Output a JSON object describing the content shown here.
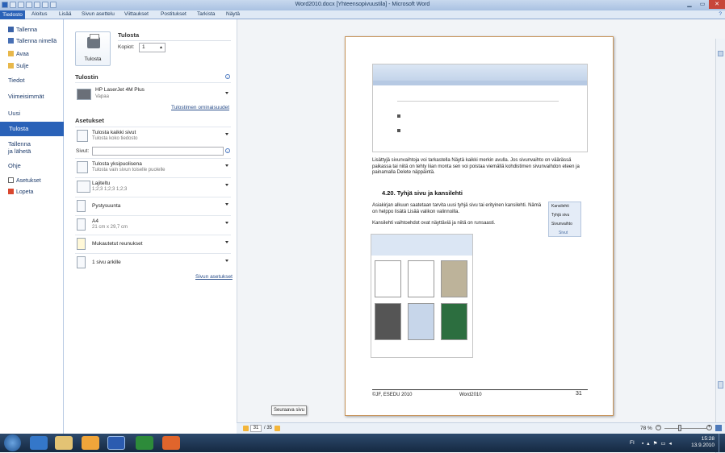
{
  "window": {
    "title": "Word2010.docx [Yhteensopivuustila] - Microsoft Word"
  },
  "ribbon": {
    "file": "Tiedosto",
    "tabs": [
      "Aloitus",
      "Lisää",
      "Sivun asettelu",
      "Viittaukset",
      "Postitukset",
      "Tarkista",
      "Näytä"
    ]
  },
  "nav": {
    "save": "Tallenna",
    "save_as": "Tallenna nimellä",
    "open": "Avaa",
    "close": "Sulje",
    "info": "Tiedot",
    "recent": "Viimeisimmät",
    "new": "Uusi",
    "print": "Tulosta",
    "share": "Tallenna\nja lähetä",
    "help": "Ohje",
    "options": "Asetukset",
    "exit": "Lopeta"
  },
  "print": {
    "heading": "Tulosta",
    "button": "Tulosta",
    "copies_label": "Kopiot:",
    "copies_value": "1",
    "printer_heading": "Tulostin",
    "printer_name": "HP LaserJet 4M Plus",
    "printer_status": "Vapaa",
    "printer_props": "Tulostimen ominaisuudet",
    "settings_heading": "Asetukset",
    "all_pages": "Tulosta kaikki sivut",
    "all_pages_sub": "Tulosta koko tiedosto",
    "pages_label": "Sivut:",
    "one_sided": "Tulosta yksipuolisena",
    "one_sided_sub": "Tulosta vain sivun toiselle puolelle",
    "collated": "Lajiteltu",
    "collated_sub": "1;2;3    1;2;3    1;2;3",
    "orientation": "Pystysuunta",
    "paper": "A4",
    "paper_sub": "21 cm x 29,7 cm",
    "margins": "Mukautetut reunukset",
    "per_sheet": "1 sivu arkille",
    "page_setup": "Sivun asetukset"
  },
  "preview": {
    "body1": "Lisättyjä sivunvaihtoja voi tarkastella Näytä kaikki merkin avulla. Jos sivunvaihto on väärässä paikassa tai niitä on tehty liian monta sen voi poistaa viemällä kohdistimen sivunvaihdon eteen ja painamalla Delete näppäintä.",
    "heading": "4.20.   Tyhjä sivu ja kansilehti",
    "body2": "Asiakirjan alkuun saatetaan tarvita uusi tyhjä sivu tai erityinen kansilehti. Nämä on helppo lisätä Lisää valikon valinnoilla.",
    "body3": "Kansilehti vaihtoehdot ovat näyttäviä ja niitä on runsaasti.",
    "menu": [
      "Kansilehti",
      "Tyhjä sivu",
      "Sivunvaihto",
      "Sivut"
    ],
    "footer_left": "©JF, ESEDU 2010",
    "footer_mid": "Word2010",
    "footer_page": "31",
    "tooltip": "Seuraava sivu"
  },
  "status": {
    "page_current": "31",
    "page_total": "/ 35",
    "zoom": "78 %"
  },
  "tray": {
    "lang": "FI",
    "time": "15:28",
    "date": "13.9.2010"
  }
}
